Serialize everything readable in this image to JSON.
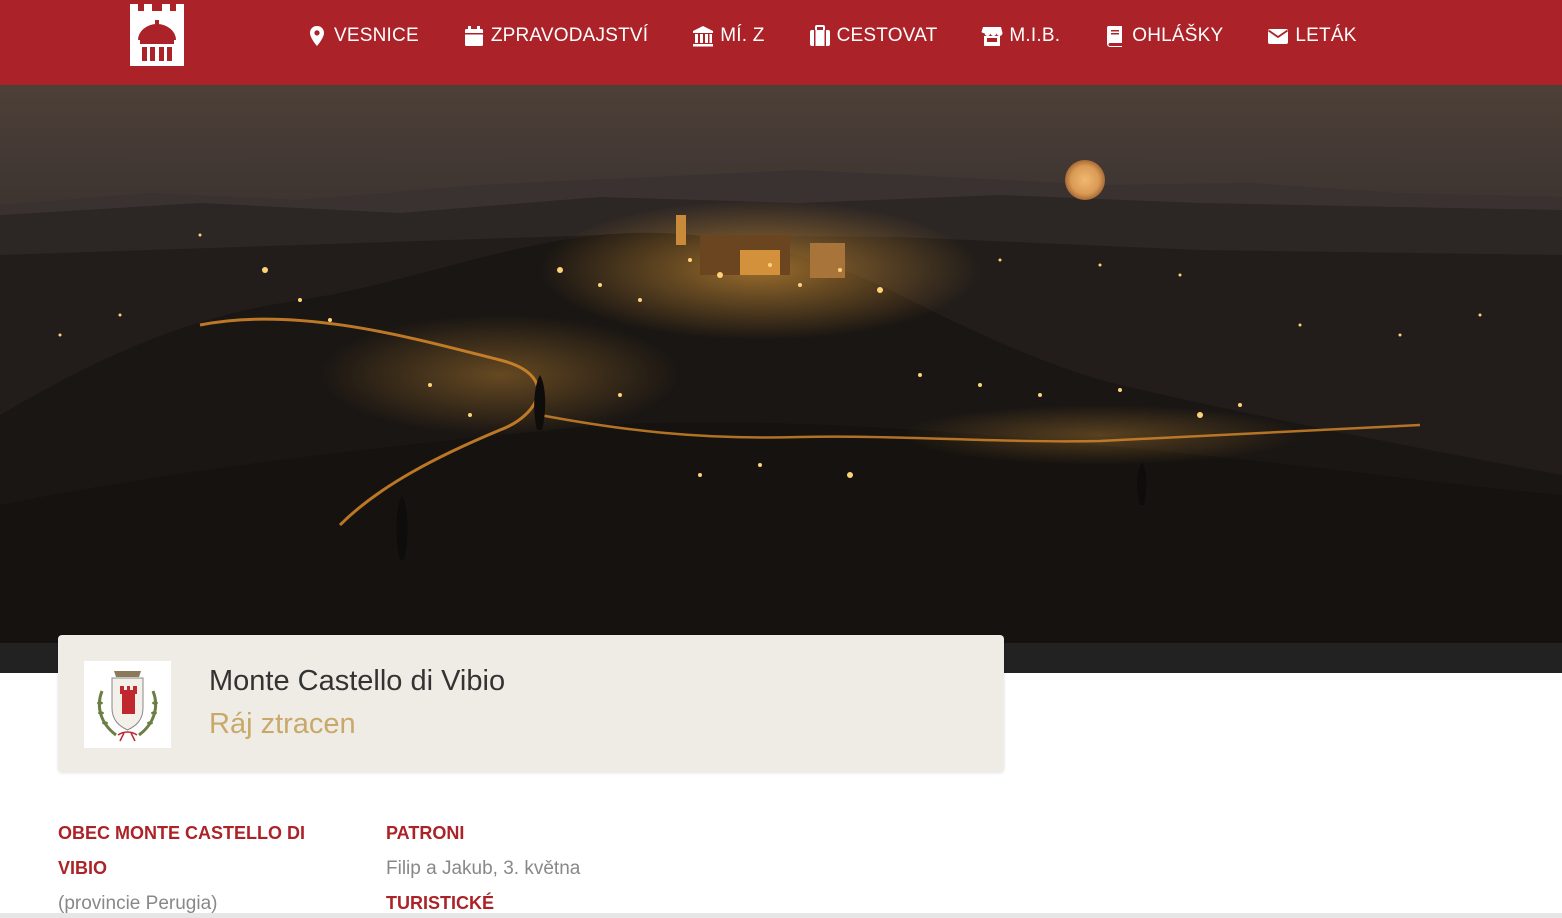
{
  "header": {
    "logo_icon": "castle-tower-icon",
    "accent_color": "#ab2328",
    "nav": [
      {
        "label": "VESNICE",
        "icon": "map-marker-icon"
      },
      {
        "label": "ZPRAVODAJSTVÍ",
        "icon": "calendar-icon"
      },
      {
        "label": "MÍ. Z",
        "icon": "museum-icon"
      },
      {
        "label": "CESTOVAT",
        "icon": "suitcase-icon"
      },
      {
        "label": "M.I.B.",
        "icon": "shop-icon"
      },
      {
        "label": "OHLÁŠKY",
        "icon": "book-icon"
      },
      {
        "label": "LETÁK",
        "icon": "envelope-icon"
      }
    ]
  },
  "title_card": {
    "name": "Monte Castello di Vibio",
    "motto": "Ráj ztracen",
    "crest_icon": "coat-of-arms-icon"
  },
  "info": {
    "municipality_heading": "OBEC MONTE CASTELLO DI VIBIO",
    "municipality_text": "(provincie Perugia)",
    "patrons_heading": "PATRONI",
    "patrons_text": "Filip a Jakub, 3. května",
    "tourism_heading": "TURISTICKÉ"
  }
}
